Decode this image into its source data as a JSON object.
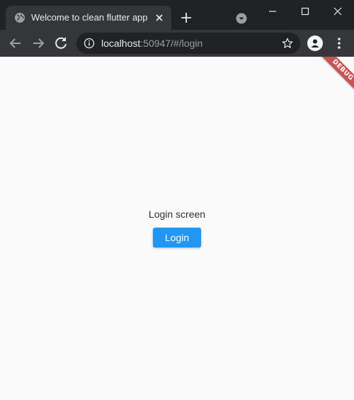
{
  "browser": {
    "tab": {
      "title": "Welcome to clean flutter app",
      "favicon": "globe-icon"
    },
    "address": {
      "host": "localhost",
      "rest": ":50947/#/login"
    },
    "colors": {
      "frame": "#202124",
      "toolbar": "#35363a",
      "text": "#e8eaed",
      "muted": "#9aa0a6"
    }
  },
  "page": {
    "debug_banner": "DEBUG",
    "label": "Login screen",
    "login_button": "Login",
    "colors": {
      "background": "#fafafa",
      "button": "#2196f3",
      "banner": "#b71c1c"
    }
  }
}
